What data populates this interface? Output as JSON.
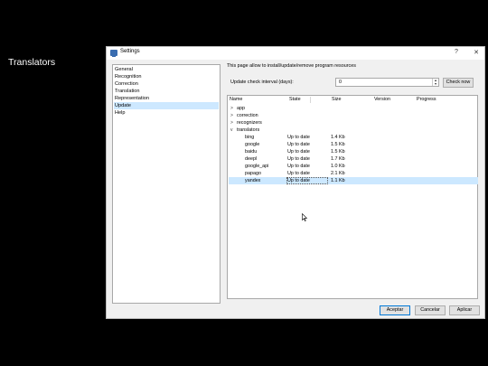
{
  "slide": {
    "title": "Translators"
  },
  "window": {
    "title": "Settings",
    "help_glyph": "?",
    "close_glyph": "✕"
  },
  "sidebar": {
    "items": [
      {
        "label": "General"
      },
      {
        "label": "Recognition"
      },
      {
        "label": "Correction"
      },
      {
        "label": "Translation"
      },
      {
        "label": "Representation"
      },
      {
        "label": "Update",
        "selected": true
      },
      {
        "label": "Help"
      }
    ]
  },
  "update_page": {
    "description": "This page allow to install/update/remove program resources",
    "interval_label": "Update check interval (days):",
    "interval_value": "0",
    "check_now_label": "Check now"
  },
  "tree": {
    "columns": [
      "Name",
      "State",
      "Size",
      "Version",
      "Progress"
    ],
    "rows": [
      {
        "name": "app",
        "state": "",
        "size": "",
        "expander": ">"
      },
      {
        "name": "correction",
        "state": "",
        "size": "",
        "expander": ">"
      },
      {
        "name": "recognizers",
        "state": "",
        "size": "",
        "expander": ">"
      },
      {
        "name": "translators",
        "state": "",
        "size": "",
        "expander": "v"
      },
      {
        "name": "bing",
        "state": "Up to date",
        "size": "1.4 Kb"
      },
      {
        "name": "google",
        "state": "Up to date",
        "size": "1.5 Kb"
      },
      {
        "name": "baidu",
        "state": "Up to date",
        "size": "1.5 Kb"
      },
      {
        "name": "deepl",
        "state": "Up to date",
        "size": "1.7 Kb"
      },
      {
        "name": "google_api",
        "state": "Up to date",
        "size": "1.0 Kb"
      },
      {
        "name": "papago",
        "state": "Up to date",
        "size": "2.1 Kb"
      },
      {
        "name": "yandex",
        "state": "Up to date",
        "size": "1.1 Kb",
        "selected": true
      }
    ]
  },
  "footer": {
    "ok_label": "Aceptar",
    "cancel_label": "Cancelar",
    "apply_label": "Aplicar"
  }
}
